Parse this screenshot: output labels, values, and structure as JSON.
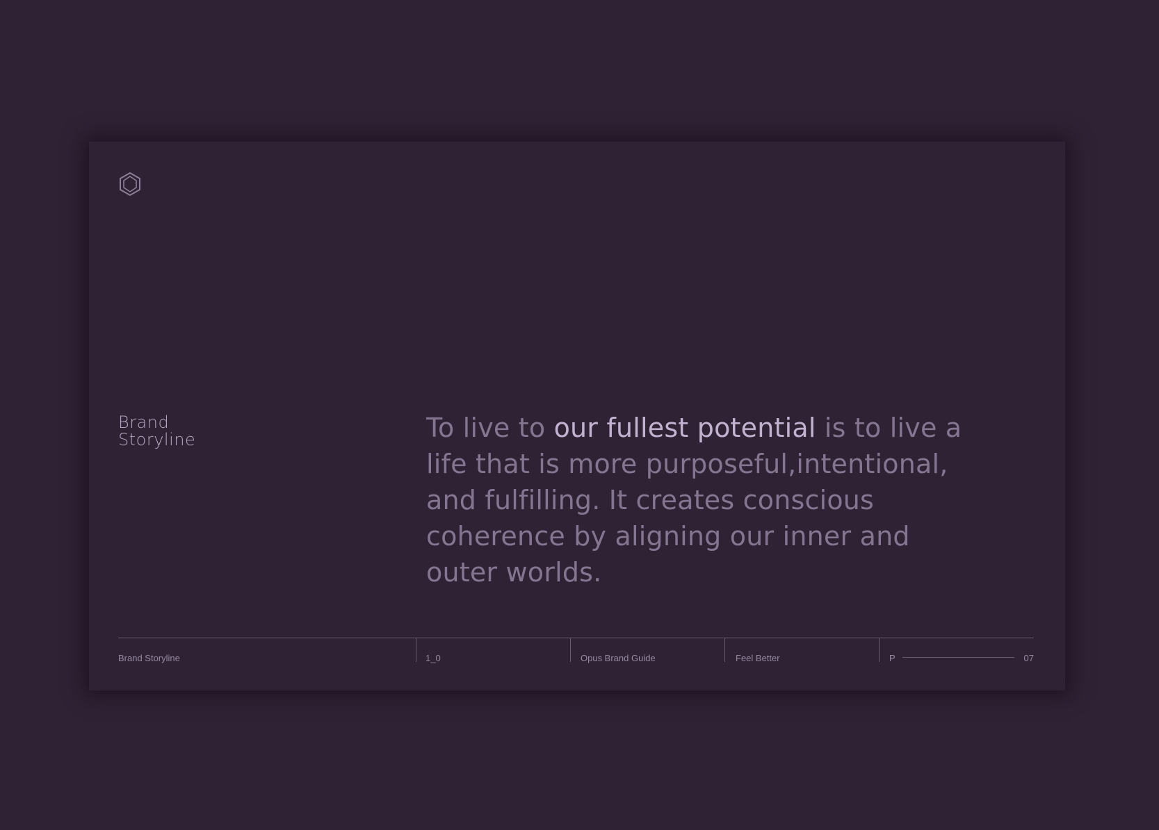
{
  "logo": {
    "icon": "hexagon-logo-icon",
    "color": "#8d7f96"
  },
  "section_title": {
    "line1": "Brand",
    "line2": "Storyline"
  },
  "quote": {
    "part1": "To live to ",
    "highlight": "our fullest potential",
    "part2": " is to live a life that is more purposeful,intentional, and fulfilling. It creates conscious coherence by aligning our inner and outer worlds."
  },
  "footer": {
    "section": "Brand Storyline",
    "version": "1_0",
    "document": "Opus Brand Guide",
    "tagline": "Feel Better",
    "page_prefix": "P",
    "page_number": "07"
  },
  "colors": {
    "background": "#2f2234",
    "text_muted": "#857590",
    "text_highlight": "#c3b2cf",
    "rule": "#6a5b73"
  }
}
